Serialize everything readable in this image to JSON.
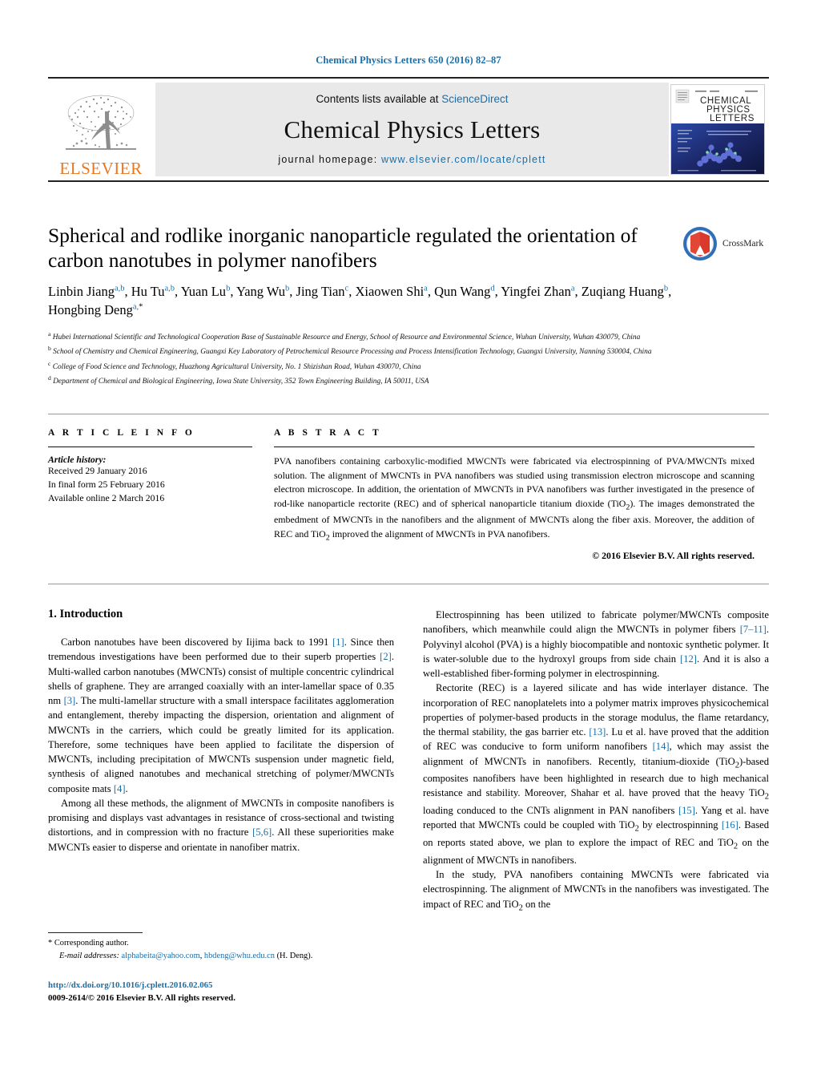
{
  "running_head": "Chemical Physics Letters 650 (2016) 82–87",
  "masthead": {
    "contents_prefix": "Contents lists available at ",
    "sciencedirect": "ScienceDirect",
    "journal_name": "Chemical Physics Letters",
    "homepage_prefix": "journal homepage: ",
    "homepage_url": "www.elsevier.com/locate/cplett",
    "publisher": "ELSEVIER",
    "cover_title_lines": [
      "CHEMICAL",
      "PHYSICS",
      "LETTERS"
    ]
  },
  "article": {
    "title": "Spherical and rodlike inorganic nanoparticle regulated the orientation of carbon nanotubes in polymer nanofibers",
    "crossmark_label": "CrossMark",
    "authors": [
      {
        "name": "Linbin Jiang",
        "marks": "a,b"
      },
      {
        "name": "Hu Tu",
        "marks": "a,b"
      },
      {
        "name": "Yuan Lu",
        "marks": "b"
      },
      {
        "name": "Yang Wu",
        "marks": "b"
      },
      {
        "name": "Jing Tian",
        "marks": "c"
      },
      {
        "name": "Xiaowen Shi",
        "marks": "a"
      },
      {
        "name": "Qun Wang",
        "marks": "d"
      },
      {
        "name": "Yingfei Zhan",
        "marks": "a"
      },
      {
        "name": "Zuqiang Huang",
        "marks": "b"
      },
      {
        "name": "Hongbing Deng",
        "marks": "a,*"
      }
    ],
    "affiliations": [
      {
        "mark": "a",
        "text": "Hubei International Scientific and Technological Cooperation Base of Sustainable Resource and Energy, School of Resource and Environmental Science, Wuhan University, Wuhan 430079, China"
      },
      {
        "mark": "b",
        "text": "School of Chemistry and Chemical Engineering, Guangxi Key Laboratory of Petrochemical Resource Processing and Process Intensification Technology, Guangxi University, Nanning 530004, China"
      },
      {
        "mark": "c",
        "text": "College of Food Science and Technology, Huazhong Agricultural University, No. 1 Shizishan Road, Wuhan 430070, China"
      },
      {
        "mark": "d",
        "text": "Department of Chemical and Biological Engineering, Iowa State University, 352 Town Engineering Building, IA 50011, USA"
      }
    ]
  },
  "article_info": {
    "heading": "A R T I C L E    I N F O",
    "history_label": "Article history:",
    "history": [
      "Received 29 January 2016",
      "In final form 25 February 2016",
      "Available online 2 March 2016"
    ]
  },
  "abstract": {
    "heading": "A B S T R A C T",
    "text": "PVA nanofibers containing carboxylic-modified MWCNTs were fabricated via electrospinning of PVA/MWCNTs mixed solution. The alignment of MWCNTs in PVA nanofibers was studied using transmission electron microscope and scanning electron microscope. In addition, the orientation of MWCNTs in PVA nanofibers was further investigated in the presence of rod-like nanoparticle rectorite (REC) and of spherical nanoparticle titanium dioxide (TiO2). The images demonstrated the embedment of MWCNTs in the nanofibers and the alignment of MWCNTs along the fiber axis. Moreover, the addition of REC and TiO2 improved the alignment of MWCNTs in PVA nanofibers.",
    "copyright": "© 2016 Elsevier B.V. All rights reserved."
  },
  "introduction": {
    "heading": "1. Introduction",
    "left_paragraphs": [
      "Carbon nanotubes have been discovered by Iijima back to 1991 [1]. Since then tremendous investigations have been performed due to their superb properties [2]. Multi-walled carbon nanotubes (MWCNTs) consist of multiple concentric cylindrical shells of graphene. They are arranged coaxially with an inter-lamellar space of 0.35 nm [3]. The multi-lamellar structure with a small interspace facilitates agglomeration and entanglement, thereby impacting the dispersion, orientation and alignment of MWCNTs in the carriers, which could be greatly limited for its application. Therefore, some techniques have been applied to facilitate the dispersion of MWCNTs, including precipitation of MWCNTs suspension under magnetic field, synthesis of aligned nanotubes and mechanical stretching of polymer/MWCNTs composite mats [4].",
      "Among all these methods, the alignment of MWCNTs in composite nanofibers is promising and displays vast advantages in resistance of cross-sectional and twisting distortions, and in compression with no fracture [5,6]. All these superiorities make MWCNTs easier to disperse and orientate in nanofiber matrix."
    ],
    "right_paragraphs": [
      "Electrospinning has been utilized to fabricate polymer/MWCNTs composite nanofibers, which meanwhile could align the MWCNTs in polymer fibers [7–11]. Polyvinyl alcohol (PVA) is a highly biocompatible and nontoxic synthetic polymer. It is water-soluble due to the hydroxyl groups from side chain [12]. And it is also a well-established fiber-forming polymer in electrospinning.",
      "Rectorite (REC) is a layered silicate and has wide interlayer distance. The incorporation of REC nanoplatelets into a polymer matrix improves physicochemical properties of polymer-based products in the storage modulus, the flame retardancy, the thermal stability, the gas barrier etc. [13]. Lu et al. have proved that the addition of REC was conducive to form uniform nanofibers [14], which may assist the alignment of MWCNTs in nanofibers. Recently, titanium-dioxide (TiO2)-based composites nanofibers have been highlighted in research due to high mechanical resistance and stability. Moreover, Shahar et al. have proved that the heavy TiO2 loading conduced to the CNTs alignment in PAN nanofibers [15]. Yang et al. have reported that MWCNTs could be coupled with TiO2 by electrospinning [16]. Based on reports stated above, we plan to explore the impact of REC and TiO2 on the alignment of MWCNTs in nanofibers.",
      "In the study, PVA nanofibers containing MWCNTs were fabricated via electrospinning. The alignment of MWCNTs in the nanofibers was investigated. The impact of REC and TiO2 on the"
    ]
  },
  "footer": {
    "corresponding_marker": "*",
    "corresponding_label": "Corresponding author.",
    "email_label": "E-mail addresses:",
    "email_1": "alphabeita@yahoo.com",
    "email_sep": ", ",
    "email_2": "hbdeng@whu.edu.cn",
    "email_suffix": " (H. Deng).",
    "doi": "http://dx.doi.org/10.1016/j.cplett.2016.02.065",
    "issn_line": "0009-2614/© 2016 Elsevier B.V. All rights reserved."
  },
  "colors": {
    "link": "#1a6ea8",
    "elsevier_orange": "#E87722",
    "band_gray": "#e9e9e9"
  }
}
